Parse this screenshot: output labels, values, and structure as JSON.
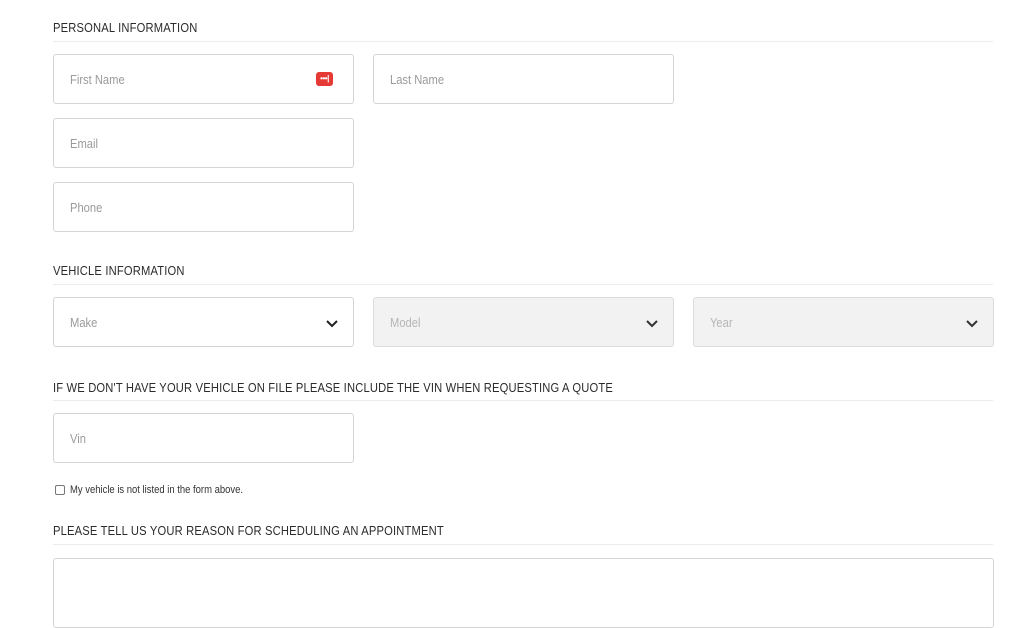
{
  "sections": {
    "personal": "PERSONAL INFORMATION",
    "vehicle": "VEHICLE INFORMATION",
    "vin_note": "IF WE DON'T HAVE YOUR VEHICLE ON FILE PLEASE INCLUDE THE VIN WHEN REQUESTING A QUOTE",
    "reason": "PLEASE TELL US YOUR REASON FOR SCHEDULING AN APPOINTMENT"
  },
  "fields": {
    "first_name": "First Name",
    "last_name": "Last Name",
    "email": "Email",
    "phone": "Phone",
    "make": "Make",
    "model": "Model",
    "year": "Year",
    "vin": "Vin"
  },
  "checkbox": {
    "label": "My vehicle is not listed in the form above.",
    "checked": false
  },
  "icons": {
    "password_manager": "password-manager-icon",
    "dropdown": "chevron-down-icon"
  },
  "colors": {
    "password_icon": "#e53935",
    "border": "#d4d4d4",
    "disabled_bg": "#f2f2f2"
  }
}
